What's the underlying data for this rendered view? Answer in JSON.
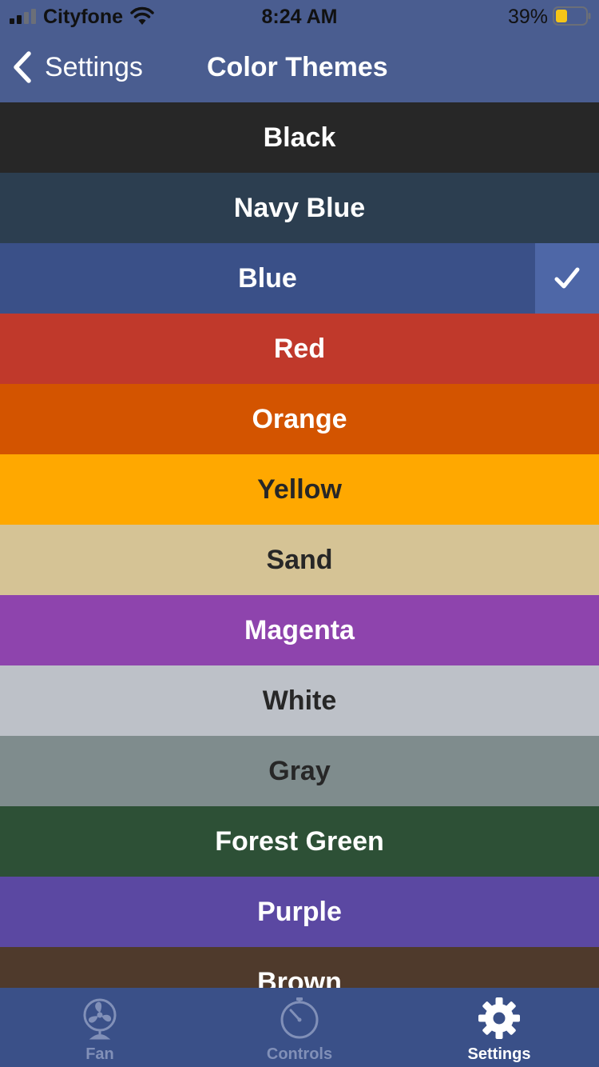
{
  "status_bar": {
    "carrier": "Cityfone",
    "time": "8:24 AM",
    "battery_percent": "39%",
    "battery_level": 0.39,
    "battery_color": "#f5c518"
  },
  "nav": {
    "back_label": "Settings",
    "title": "Color Themes"
  },
  "themes": [
    {
      "label": "Black",
      "bg": "#272727",
      "fg": "#ffffff",
      "selected": false
    },
    {
      "label": "Navy Blue",
      "bg": "#2c3e50",
      "fg": "#ffffff",
      "selected": false
    },
    {
      "label": "Blue",
      "bg": "#3a5088",
      "fg": "#ffffff",
      "selected": true
    },
    {
      "label": "Red",
      "bg": "#c0392b",
      "fg": "#ffffff",
      "selected": false
    },
    {
      "label": "Orange",
      "bg": "#d35400",
      "fg": "#ffffff",
      "selected": false
    },
    {
      "label": "Yellow",
      "bg": "#ffa800",
      "fg": "#272727",
      "selected": false
    },
    {
      "label": "Sand",
      "bg": "#d5c395",
      "fg": "#272727",
      "selected": false
    },
    {
      "label": "Magenta",
      "bg": "#8e44ad",
      "fg": "#ffffff",
      "selected": false
    },
    {
      "label": "White",
      "bg": "#bdc1c8",
      "fg": "#272727",
      "selected": false
    },
    {
      "label": "Gray",
      "bg": "#7f8c8d",
      "fg": "#272727",
      "selected": false
    },
    {
      "label": "Forest Green",
      "bg": "#2d5036",
      "fg": "#ffffff",
      "selected": false
    },
    {
      "label": "Purple",
      "bg": "#5b48a2",
      "fg": "#ffffff",
      "selected": false
    },
    {
      "label": "Brown",
      "bg": "#4f3a2c",
      "fg": "#ffffff",
      "selected": false
    }
  ],
  "selected_icon": "checkmark-icon",
  "tabs": [
    {
      "label": "Fan",
      "icon": "fan-icon",
      "active": false
    },
    {
      "label": "Controls",
      "icon": "gauge-icon",
      "active": false
    },
    {
      "label": "Settings",
      "icon": "gear-icon",
      "active": true
    }
  ],
  "colors": {
    "header_bg": "#4a5d90",
    "tab_bar_bg": "#3a5088",
    "tab_active": "#ffffff",
    "tab_inactive": "#8190b8",
    "checkmark_cell_bg": "#4e67a7"
  }
}
